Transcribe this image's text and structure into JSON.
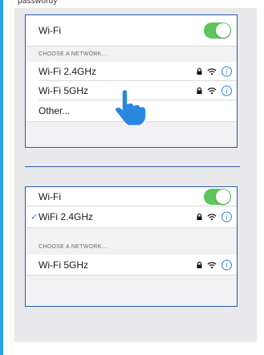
{
  "caption": "passwordy",
  "accent": "#2b7de9",
  "toggle_on_color": "#5cc65c",
  "panel1": {
    "wifi_label": "Wi-Fi",
    "wifi_toggle_on": true,
    "section_label": "CHOOSE A NETWORK...",
    "networks": [
      {
        "name": "Wi-Fi 2.4GHz",
        "locked": true,
        "icon": "wifi-icon"
      },
      {
        "name": "Wi-Fi 5GHz",
        "locked": true,
        "icon": "wifi-icon"
      }
    ],
    "other_label": "Other..."
  },
  "panel2": {
    "wifi_label": "Wi-Fi",
    "wifi_toggle_on": true,
    "connected_network": "WiFi 2.4GHz",
    "section_label": "CHOOSE A NETWORK...",
    "networks": [
      {
        "name": "Wi-Fi 5GHz",
        "locked": true,
        "icon": "wifi-icon"
      }
    ]
  },
  "info_glyph": "i",
  "check_glyph": "✓"
}
